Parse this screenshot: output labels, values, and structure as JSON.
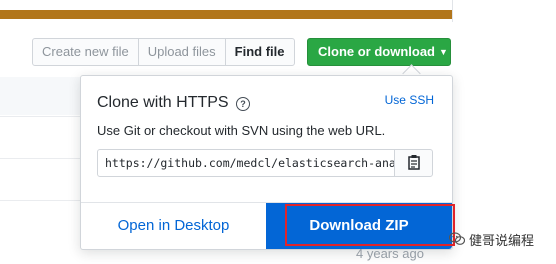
{
  "toolbar": {
    "create_new_file": "Create new file",
    "upload_files": "Upload files",
    "find_file": "Find file",
    "clone_or_download": "Clone or download"
  },
  "clone_popover": {
    "title": "Clone with HTTPS",
    "use_ssh": "Use SSH",
    "description": "Use Git or checkout with SVN using the web URL.",
    "url_value": "https://github.com/medcl/elasticsearch-analysis-ik.git",
    "open_in_desktop": "Open in Desktop",
    "download_zip": "Download ZIP"
  },
  "file_list": {
    "last_commit_time": "4 years ago"
  },
  "watermark": {
    "text": "健哥说编程"
  },
  "colors": {
    "language_bar": "#b2761b",
    "clone_button": "#2aa744",
    "download_button": "#0366d6",
    "link": "#0366d6",
    "highlight_box": "#e0242a"
  },
  "icons": {
    "help": "question-circle-icon",
    "copy": "clipboard-icon",
    "caret": "caret-down-icon",
    "watermark": "wechat-icon"
  }
}
